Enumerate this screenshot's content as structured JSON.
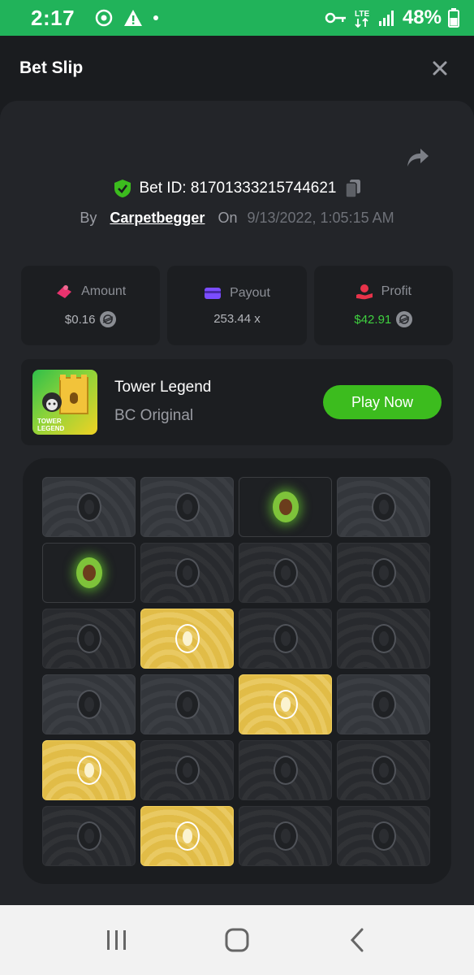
{
  "status_bar": {
    "time": "2:17",
    "network": "LTE",
    "battery": "48%"
  },
  "header": {
    "title": "Bet Slip"
  },
  "bet": {
    "id_label": "Bet ID: 81701333215744621",
    "by_label": "By",
    "username": "Carpetbegger",
    "on_label": "On",
    "date": "9/13/2022, 1:05:15 AM"
  },
  "stats": {
    "amount": {
      "label": "Amount",
      "value": "$0.16"
    },
    "payout": {
      "label": "Payout",
      "value": "253.44 x"
    },
    "profit": {
      "label": "Profit",
      "value": "$42.91"
    }
  },
  "game": {
    "name": "Tower Legend",
    "provider": "BC Original",
    "thumb_text": "TOWER LEGEND",
    "play_label": "Play Now"
  },
  "board": {
    "rows": [
      [
        "lit",
        "lit",
        "avocado",
        "lit"
      ],
      [
        "avocado",
        "dim",
        "dim",
        "dim"
      ],
      [
        "dim",
        "gold",
        "dim",
        "dim"
      ],
      [
        "lit",
        "lit",
        "gold",
        "lit"
      ],
      [
        "gold",
        "dim",
        "dim",
        "dim"
      ],
      [
        "dim",
        "gold",
        "dim",
        "dim"
      ]
    ]
  },
  "colors": {
    "accent_green": "#3cbc1e",
    "status_green": "#21b35a",
    "profit_green": "#3fd03f",
    "gold_tile": "#e6c24c"
  },
  "icons": {
    "shield": "shield-check-icon",
    "copy": "copy-icon",
    "share": "share-icon",
    "close": "close-icon",
    "amount": "amount-icon",
    "payout": "wallet-icon",
    "profit": "profit-icon",
    "coin": "stellar-coin-icon"
  }
}
